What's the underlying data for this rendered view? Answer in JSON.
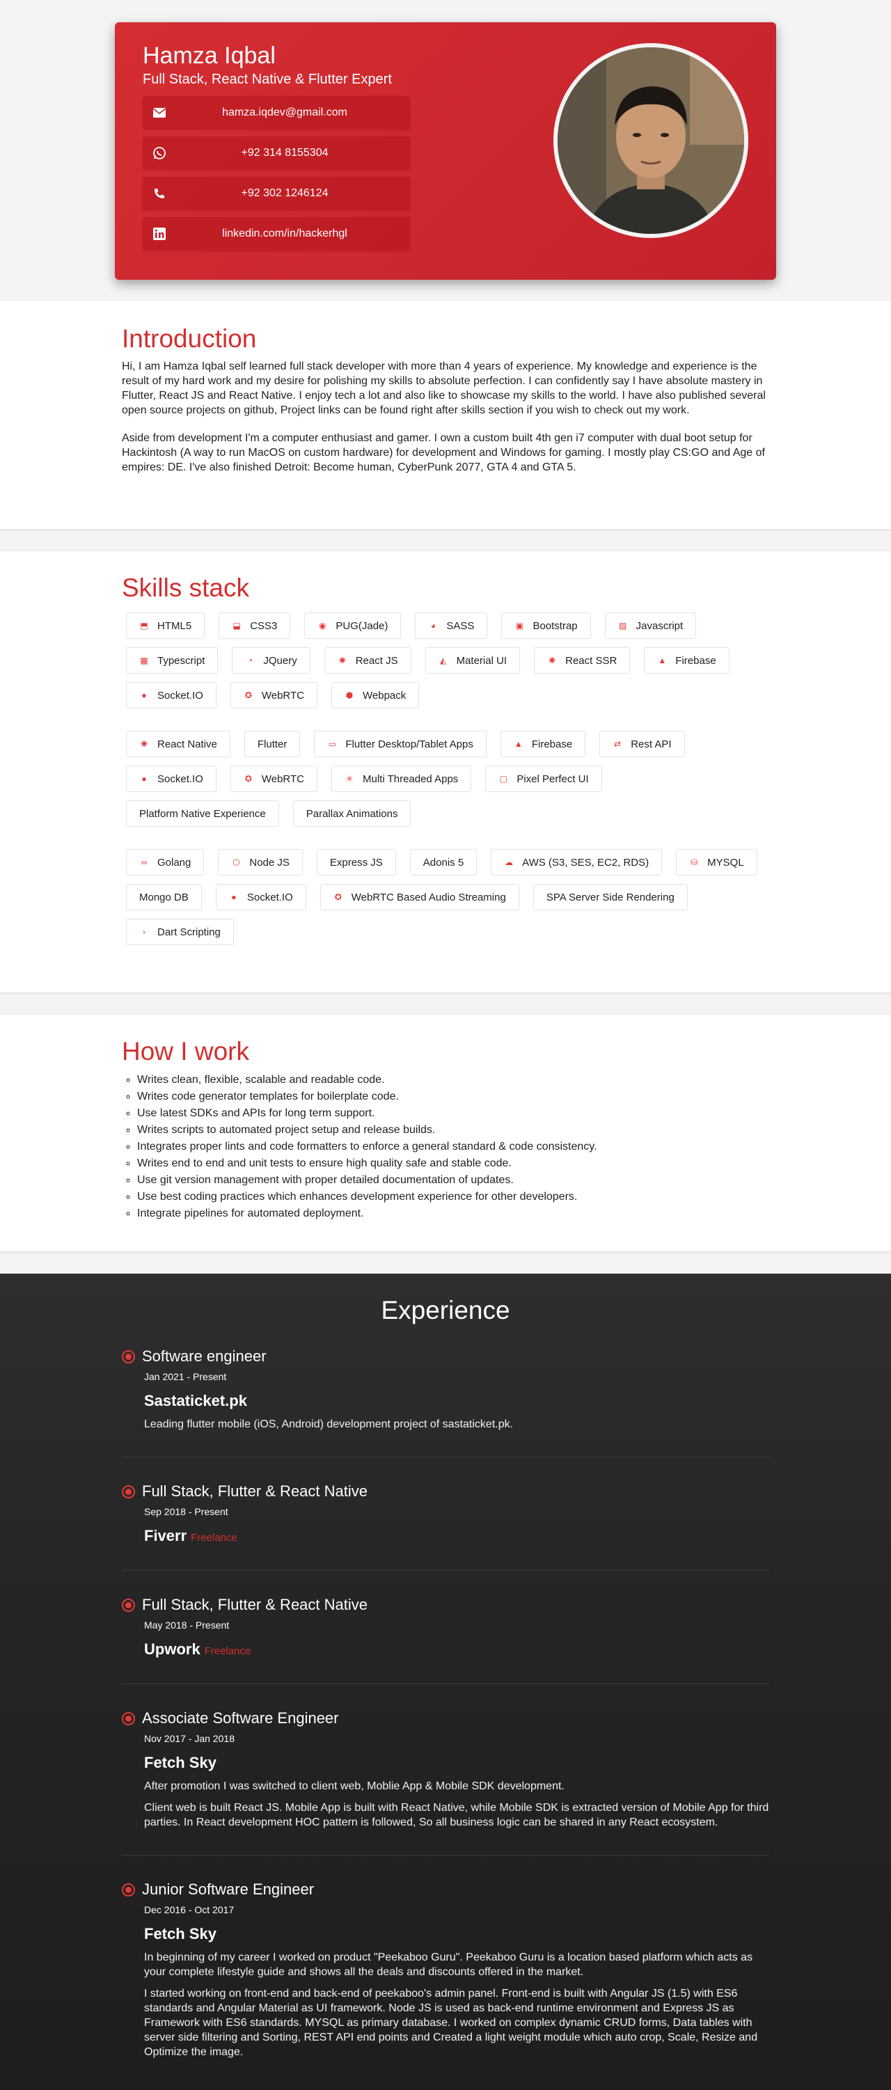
{
  "profile": {
    "name": "Hamza Iqbal",
    "title": "Full Stack, React Native & Flutter Expert",
    "contacts": [
      {
        "icon": "email-icon",
        "text": "hamza.iqdev@gmail.com"
      },
      {
        "icon": "whatsapp-icon",
        "text": "+92 314 8155304"
      },
      {
        "icon": "phone-icon",
        "text": "+92 302 1246124"
      },
      {
        "icon": "linkedin-icon",
        "text": "linkedin.com/in/hackerhgl"
      }
    ]
  },
  "intro": {
    "title": "Introduction",
    "p1": "Hi, I am Hamza Iqbal self learned full stack developer with more than 4 years of experience. My knowledge and experience is the result of my hard work and my desire for polishing my skills to absolute perfection. I can confidently say I have absolute mastery in Flutter, React JS and React Native. I enjoy tech a lot and also like to showcase my skills to the world. I have also published several open source projects on github, Project links can be found right after skills section if you wish to check out my work.",
    "p2": "Aside from development I'm a computer enthusiast and gamer. I own a custom built 4th gen i7 computer with dual boot setup for Hackintosh (A way to run MacOS on custom hardware) for development and Windows for gaming. I mostly play CS:GO and Age of empires: DE. I've also finished Detroit: Become human, CyberPunk 2077, GTA 4 and GTA 5."
  },
  "skills": {
    "title": "Skills stack",
    "groups": [
      [
        {
          "icon": "html5-icon",
          "label": "HTML5"
        },
        {
          "icon": "css3-icon",
          "label": "CSS3"
        },
        {
          "icon": "pug-icon",
          "label": "PUG(Jade)"
        },
        {
          "icon": "sass-icon",
          "label": "SASS"
        },
        {
          "icon": "bootstrap-icon",
          "label": "Bootstrap"
        },
        {
          "icon": "javascript-icon",
          "label": "Javascript"
        },
        {
          "icon": "typescript-icon",
          "label": "Typescript"
        },
        {
          "icon": "jquery-icon",
          "label": "JQuery"
        },
        {
          "icon": "react-icon",
          "label": "React JS"
        },
        {
          "icon": "material-ui-icon",
          "label": "Material UI"
        },
        {
          "icon": "react-icon",
          "label": "React SSR"
        },
        {
          "icon": "firebase-icon",
          "label": "Firebase"
        },
        {
          "icon": "socketio-icon",
          "label": "Socket.IO"
        },
        {
          "icon": "webrtc-icon",
          "label": "WebRTC"
        },
        {
          "icon": "webpack-icon",
          "label": "Webpack"
        }
      ],
      [
        {
          "icon": "react-icon",
          "label": "React Native"
        },
        {
          "icon": "",
          "label": "Flutter"
        },
        {
          "icon": "desktop-icon",
          "label": "Flutter Desktop/Tablet Apps"
        },
        {
          "icon": "firebase-icon",
          "label": "Firebase"
        },
        {
          "icon": "api-icon",
          "label": "Rest API"
        },
        {
          "icon": "socketio-icon",
          "label": "Socket.IO"
        },
        {
          "icon": "webrtc-icon",
          "label": "WebRTC"
        },
        {
          "icon": "threads-icon",
          "label": "Multi Threaded Apps"
        },
        {
          "icon": "pixel-icon",
          "label": "Pixel Perfect UI"
        },
        {
          "icon": "",
          "label": "Platform Native Experience"
        },
        {
          "icon": "",
          "label": "Parallax Animations"
        }
      ],
      [
        {
          "icon": "golang-icon",
          "label": "Golang"
        },
        {
          "icon": "nodejs-icon",
          "label": "Node JS"
        },
        {
          "icon": "",
          "label": "Express JS"
        },
        {
          "icon": "",
          "label": "Adonis 5"
        },
        {
          "icon": "aws-icon",
          "label": "AWS (S3, SES, EC2, RDS)"
        },
        {
          "icon": "mysql-icon",
          "label": "MYSQL"
        },
        {
          "icon": "",
          "label": "Mongo DB"
        },
        {
          "icon": "socketio-icon",
          "label": "Socket.IO"
        },
        {
          "icon": "webrtc-icon",
          "label": "WebRTC Based Audio Streaming"
        },
        {
          "icon": "",
          "label": "SPA Server Side Rendering"
        },
        {
          "icon": "terminal-icon",
          "label": "Dart Scripting"
        }
      ]
    ]
  },
  "how": {
    "title": "How I work",
    "items": [
      "Writes clean, flexible, scalable and readable code.",
      "Writes code generator templates for boilerplate code.",
      "Use latest SDKs and APIs for long term support.",
      "Writes scripts to automated project setup and release builds.",
      "Integrates proper lints and code formatters to enforce a general standard & code consistency.",
      "Writes end to end and unit tests to ensure high quality safe and stable code.",
      "Use git version management with proper detailed documentation of updates.",
      "Use best coding practices which enhances development experience for other developers.",
      "Integrate pipelines for automated deployment."
    ]
  },
  "experience": {
    "title": "Experience",
    "jobs": [
      {
        "role": "Software engineer",
        "date": "Jan 2021 - Present",
        "company": "Sastaticket.pk",
        "tag": "",
        "paragraphs": [
          "Leading flutter mobile (iOS, Android) development project of sastaticket.pk."
        ]
      },
      {
        "role": "Full Stack, Flutter & React Native",
        "date": "Sep 2018 - Present",
        "company": "Fiverr",
        "tag": "Freelance",
        "paragraphs": []
      },
      {
        "role": "Full Stack, Flutter & React Native",
        "date": "May 2018 - Present",
        "company": "Upwork",
        "tag": "Freelance",
        "paragraphs": []
      },
      {
        "role": "Associate Software Engineer",
        "date": "Nov 2017 - Jan 2018",
        "company": "Fetch Sky",
        "tag": "",
        "paragraphs": [
          "After promotion I was switched to client web, Moblie App & Mobile SDK development.",
          "Client web is built React JS. Mobile App is built with React Native, while Mobile SDK is extracted version of Mobile App for third parties. In React development HOC pattern is followed, So all business logic can be shared in any React ecosystem."
        ]
      },
      {
        "role": "Junior Software Engineer",
        "date": "Dec 2016 - Oct 2017",
        "company": "Fetch Sky",
        "tag": "",
        "paragraphs": [
          "In beginning of my career I worked on product \"Peekaboo Guru\". Peekaboo Guru is a location based platform which acts as your complete lifestyle guide and shows all the deals and discounts offered in the market.",
          "I started working on front-end and back-end of peekaboo's admin panel. Front-end is built with Angular JS (1.5) with ES6 standards and Angular Material as UI framework. Node JS is used as back-end runtime environment and Express JS as Framework with ES6 standards. MYSQL as primary database. I worked on complex dynamic CRUD forms, Data tables with server side filtering and Sorting, REST API end points and Created a light weight module which auto crop, Scale, Resize and Optimize the image."
        ]
      }
    ]
  },
  "colors": {
    "accent": "#d32f2f",
    "dark_bg": "#252525"
  }
}
